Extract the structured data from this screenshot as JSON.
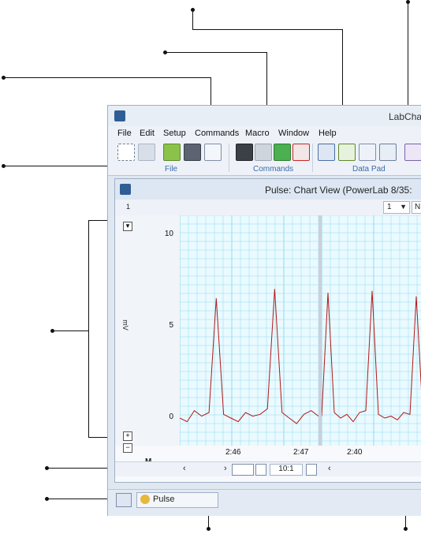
{
  "app": {
    "title": "LabCha"
  },
  "menu": [
    "File",
    "Edit",
    "Setup",
    "Commands",
    "Macro",
    "Window",
    "Help"
  ],
  "ribbon_groups": {
    "file": "File",
    "commands": "Commands",
    "data_pad": "Data Pad"
  },
  "document": {
    "title": "Pulse: Chart View (PowerLab 8/35:",
    "channel_number": "1",
    "channel_select_value": "1",
    "partial_field": "N"
  },
  "y_axis": {
    "unit": "mV",
    "ticks": [
      "10",
      "5",
      "0"
    ],
    "zoom_in": "+",
    "zoom_out": "−",
    "marker": "M"
  },
  "x_axis": {
    "ticks_block1": [
      "2:46",
      "2:47"
    ],
    "ticks_block2": [
      "2:40"
    ],
    "compression": "10:1"
  },
  "status": {
    "tab_label": "Pulse"
  },
  "colors": {
    "trace": "#b21818",
    "grid": "#8fdcef",
    "plot_bg": "#eafaff",
    "accent": "#3a6aa8"
  },
  "chart_data": {
    "type": "line",
    "ylabel": "mV",
    "ylim": [
      -1.5,
      11
    ],
    "series": [
      {
        "values": [
          0,
          -0.2,
          0.4,
          0.1,
          0.3,
          6.5,
          0.2,
          0.0,
          -0.2,
          0.3,
          0.1,
          0.2,
          0.5,
          7.0,
          0.3,
          0.0,
          -0.3,
          0.2,
          0.4,
          0.1
        ]
      },
      {
        "values": [
          0.1,
          6.8,
          0.3,
          0.0,
          0.2,
          -0.2,
          0.3,
          0.4,
          6.9,
          0.2,
          0.0,
          0.1,
          -0.1,
          0.3,
          0.2,
          6.6,
          0.4
        ]
      }
    ]
  }
}
